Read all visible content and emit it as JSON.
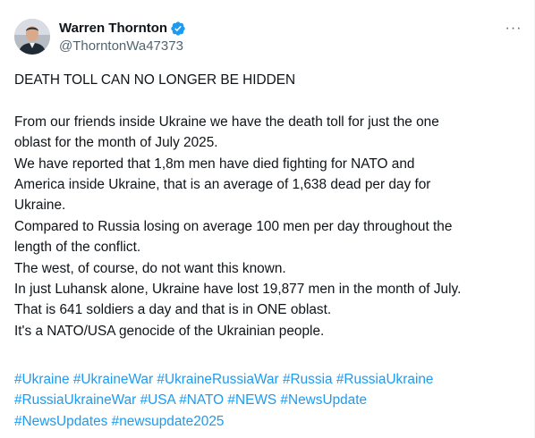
{
  "tweet": {
    "author": {
      "display_name": "Warren Thornton",
      "handle": "@ThorntonWa47373",
      "verified": true,
      "verified_color": "#1d9bf0"
    },
    "more_label": "···",
    "headline": "DEATH TOLL CAN NO LONGER BE HIDDEN",
    "lines": [
      "From our friends inside Ukraine we have the death toll for just the one",
      "oblast for the month of July 2025.",
      "We have reported that 1,8m men have died fighting for NATO and",
      "America inside Ukraine, that is an average of 1,638 dead per day for",
      "Ukraine.",
      "Compared to Russia losing on average 100 men per day throughout the",
      "length of the conflict.",
      "The west, of course, do not want this known.",
      "In just Luhansk alone, Ukraine have lost 19,877 men in the month of July.",
      "That is 641 soldiers a day and that is in ONE oblast.",
      "It's a NATO/USA genocide of the Ukrainian people."
    ],
    "hashtag_lines": [
      [
        "#Ukraine",
        "#UkraineWar",
        "#UkraineRussiaWar",
        "#Russia",
        "#RussiaUkraine"
      ],
      [
        "#RussiaUkraineWar",
        "#USA",
        "#NATO",
        "#NEWS",
        "#NewsUpdate"
      ],
      [
        "#NewsUpdates",
        "#newsupdate2025"
      ]
    ],
    "hashtag_color": "#1d9bf0"
  }
}
